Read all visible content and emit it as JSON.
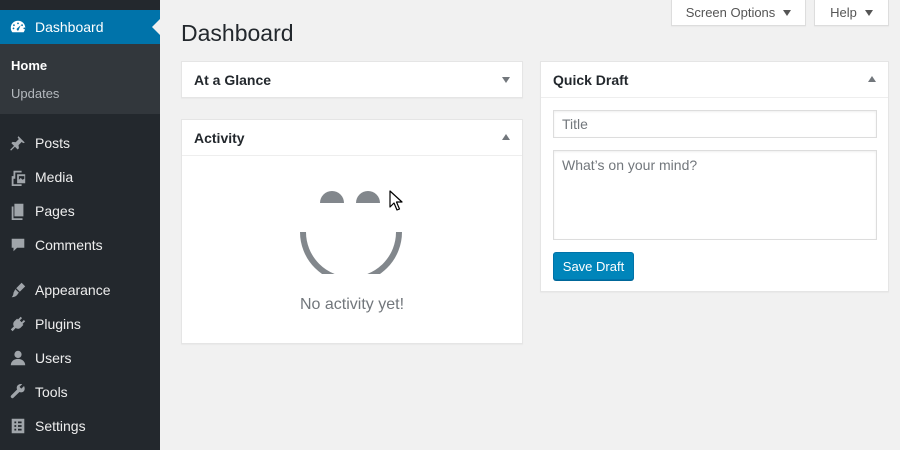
{
  "sidebar": {
    "items": [
      {
        "id": "dashboard",
        "label": "Dashboard",
        "icon": "dashboard-icon"
      },
      {
        "id": "posts",
        "label": "Posts",
        "icon": "pin-icon"
      },
      {
        "id": "media",
        "label": "Media",
        "icon": "media-icon"
      },
      {
        "id": "pages",
        "label": "Pages",
        "icon": "pages-icon"
      },
      {
        "id": "comments",
        "label": "Comments",
        "icon": "comment-icon"
      },
      {
        "id": "appearance",
        "label": "Appearance",
        "icon": "brush-icon"
      },
      {
        "id": "plugins",
        "label": "Plugins",
        "icon": "plug-icon"
      },
      {
        "id": "users",
        "label": "Users",
        "icon": "user-icon"
      },
      {
        "id": "tools",
        "label": "Tools",
        "icon": "wrench-icon"
      },
      {
        "id": "settings",
        "label": "Settings",
        "icon": "settings-icon"
      }
    ],
    "submenu": {
      "home": "Home",
      "updates": "Updates"
    },
    "colors": {
      "background": "#23282d",
      "active": "#0073aa",
      "submenu": "#32373c"
    }
  },
  "header": {
    "title": "Dashboard",
    "screen_options": "Screen Options",
    "help": "Help"
  },
  "widgets": {
    "at_a_glance": {
      "title": "At a Glance"
    },
    "activity": {
      "title": "Activity",
      "empty_text": "No activity yet!"
    },
    "quick_draft": {
      "title": "Quick Draft",
      "title_placeholder": "Title",
      "content_placeholder": "What’s on your mind?",
      "save_label": "Save Draft"
    }
  },
  "colors": {
    "accent": "#0085ba",
    "page_bg": "#f1f1f1"
  }
}
